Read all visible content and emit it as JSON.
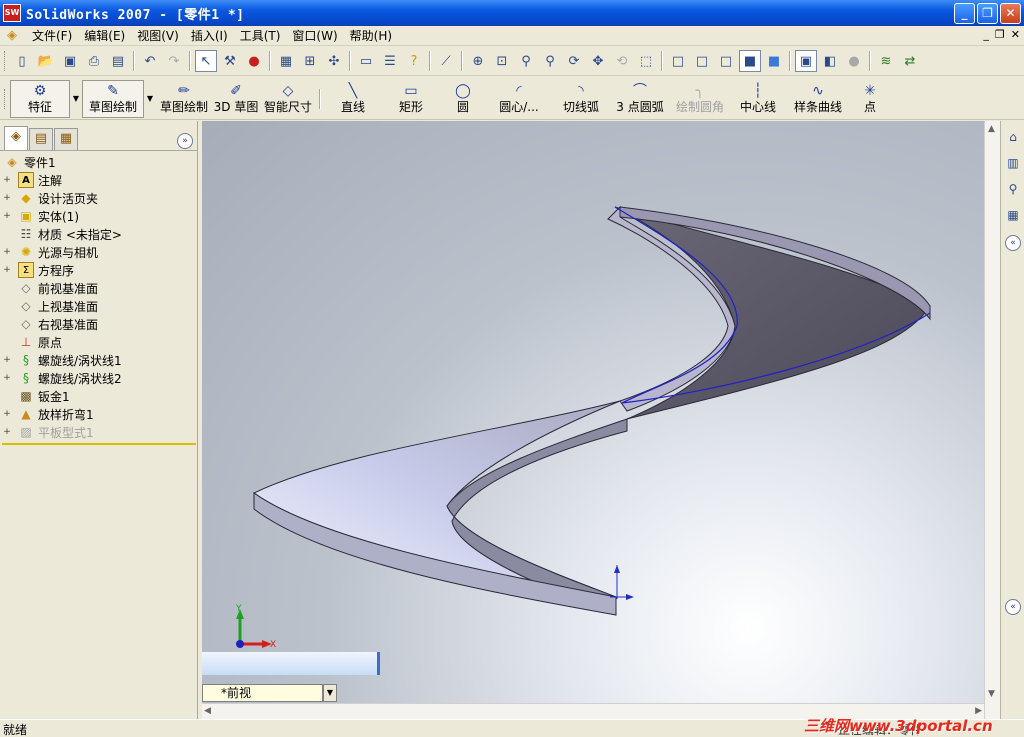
{
  "window": {
    "title": "SolidWorks 2007 - [零件1 *]",
    "app_icon": "SW"
  },
  "menu": {
    "items": [
      "文件(F)",
      "编辑(E)",
      "视图(V)",
      "插入(I)",
      "工具(T)",
      "窗口(W)",
      "帮助(H)"
    ]
  },
  "toolbar1": {
    "icons": [
      "new-icon",
      "open-icon",
      "save-icon",
      "print-icon",
      "print-preview-icon",
      "undo-icon",
      "redo-icon",
      "select-icon",
      "rebuild-icon",
      "traffic-light-icon",
      "options-icon",
      "grid-icon",
      "view-orientation-icon",
      "zoom-fit-icon",
      "zoom-area-icon",
      "zoom-inout-icon",
      "zoom-selection-icon",
      "rotate-icon",
      "pan-icon",
      "standard-views-icon",
      "display-style-icon"
    ]
  },
  "command_manager": {
    "features_label": "特征",
    "sketch_label": "草图绘制",
    "buttons": [
      {
        "label": "草图绘制",
        "icon": "sketch-icon",
        "enabled": true
      },
      {
        "label": "3D 草图",
        "icon": "3d-sketch-icon",
        "enabled": true
      },
      {
        "label": "智能尺寸",
        "icon": "smart-dimension-icon",
        "enabled": true
      },
      {
        "label": "直线",
        "icon": "line-icon",
        "enabled": true
      },
      {
        "label": "矩形",
        "icon": "rectangle-icon",
        "enabled": true
      },
      {
        "label": "圆",
        "icon": "circle-icon",
        "enabled": true
      },
      {
        "label": "圆心/...",
        "icon": "centerpoint-arc-icon",
        "enabled": true
      },
      {
        "label": "切线弧",
        "icon": "tangent-arc-icon",
        "enabled": true
      },
      {
        "label": "3 点圆弧",
        "icon": "3point-arc-icon",
        "enabled": true
      },
      {
        "label": "绘制圆角",
        "icon": "sketch-fillet-icon",
        "enabled": false
      },
      {
        "label": "中心线",
        "icon": "centerline-icon",
        "enabled": true
      },
      {
        "label": "样条曲线",
        "icon": "spline-icon",
        "enabled": true
      },
      {
        "label": "点",
        "icon": "point-icon",
        "enabled": true
      }
    ]
  },
  "feature_tree": {
    "root": "零件1",
    "items": [
      {
        "label": "注解",
        "icon": "annotations-icon",
        "expandable": true,
        "enabled": true
      },
      {
        "label": "设计活页夹",
        "icon": "design-binder-icon",
        "expandable": true,
        "enabled": true
      },
      {
        "label": "实体(1)",
        "icon": "solid-bodies-icon",
        "expandable": true,
        "enabled": true
      },
      {
        "label": "材质 <未指定>",
        "icon": "material-icon",
        "expandable": false,
        "enabled": true
      },
      {
        "label": "光源与相机",
        "icon": "lights-cameras-icon",
        "expandable": true,
        "enabled": true
      },
      {
        "label": "方程序",
        "icon": "equations-icon",
        "expandable": true,
        "enabled": true
      },
      {
        "label": "前视基准面",
        "icon": "plane-icon",
        "expandable": false,
        "enabled": true
      },
      {
        "label": "上视基准面",
        "icon": "plane-icon",
        "expandable": false,
        "enabled": true
      },
      {
        "label": "右视基准面",
        "icon": "plane-icon",
        "expandable": false,
        "enabled": true
      },
      {
        "label": "原点",
        "icon": "origin-icon",
        "expandable": false,
        "enabled": true
      },
      {
        "label": "螺旋线/涡状线1",
        "icon": "helix-icon",
        "expandable": true,
        "enabled": true
      },
      {
        "label": "螺旋线/涡状线2",
        "icon": "helix-icon",
        "expandable": true,
        "enabled": true
      },
      {
        "label": "钣金1",
        "icon": "sheet-metal-icon",
        "expandable": false,
        "enabled": true
      },
      {
        "label": "放样折弯1",
        "icon": "lofted-bend-icon",
        "expandable": true,
        "enabled": true
      },
      {
        "label": "平板型式1",
        "icon": "flat-pattern-icon",
        "expandable": true,
        "enabled": false
      }
    ]
  },
  "viewport": {
    "view_name": "*前视",
    "triad_x": "X",
    "triad_y": "Y"
  },
  "status": {
    "text": "就绪",
    "mode": "正在编辑：零件"
  },
  "watermark": "三维网www.3dportal.cn",
  "colors": {
    "title_bar": "#0a58e0",
    "model_surface": "#c4c8e0",
    "model_edge_curve": "#2020c8",
    "watermark": "#e8281c"
  }
}
